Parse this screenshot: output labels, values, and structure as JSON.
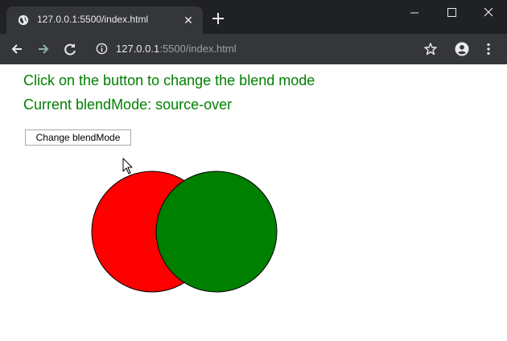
{
  "browser": {
    "tab_title": "127.0.0.1:5500/index.html",
    "tab_close_glyph": "✕",
    "address_host": "127.0.0.1",
    "address_rest": ":5500/index.html",
    "icons": [
      "globe-icon",
      "close-icon",
      "plus-icon",
      "minimize-icon",
      "maximize-icon",
      "close-window-icon",
      "back-arrow-icon",
      "forward-arrow-icon",
      "reload-icon",
      "info-icon",
      "star-icon",
      "account-icon",
      "menu-dots-icon"
    ]
  },
  "page": {
    "heading1": "Click on the button to change the blend mode",
    "heading2": "Current blendMode: source-over",
    "button_label": "Change blendMode",
    "text_color": "#008000",
    "circles": [
      {
        "name": "red-circle",
        "fill": "#ff0000"
      },
      {
        "name": "green-circle",
        "fill": "#008000"
      }
    ]
  }
}
